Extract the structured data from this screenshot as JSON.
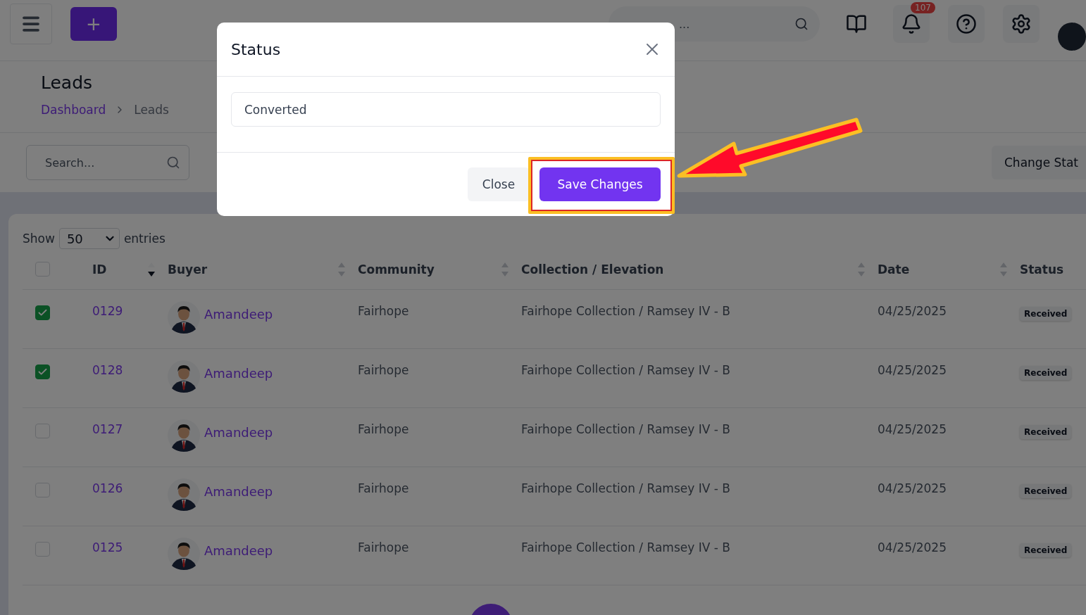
{
  "header": {
    "add_button": "+",
    "search_placeholder": "...",
    "notification_count": "107"
  },
  "page": {
    "title": "Leads",
    "breadcrumb": [
      {
        "label": "Dashboard",
        "link": true
      },
      {
        "label": "Leads",
        "link": false
      }
    ]
  },
  "toolbar": {
    "search_placeholder": "Search...",
    "change_status_button": "Change Stat"
  },
  "table": {
    "show_label": "Show",
    "page_size": "50",
    "entries_label": "entries",
    "select_all_checked": false,
    "columns": [
      {
        "label": "ID",
        "sorted_desc": true
      },
      {
        "label": "Buyer",
        "sorted_desc": false
      },
      {
        "label": "Community",
        "sorted_desc": false
      },
      {
        "label": "Collection / Elevation",
        "sorted_desc": false
      },
      {
        "label": "Date",
        "sorted_desc": false
      },
      {
        "label": "Status"
      }
    ],
    "rows": [
      {
        "checked": true,
        "id": "0129",
        "buyer": "Amandeep",
        "community": "Fairhope",
        "collection": "Fairhope Collection / Ramsey IV - B",
        "date": "04/25/2025",
        "status": "Received"
      },
      {
        "checked": true,
        "id": "0128",
        "buyer": "Amandeep",
        "community": "Fairhope",
        "collection": "Fairhope Collection / Ramsey IV - B",
        "date": "04/25/2025",
        "status": "Received"
      },
      {
        "checked": false,
        "id": "0127",
        "buyer": "Amandeep",
        "community": "Fairhope",
        "collection": "Fairhope Collection / Ramsey IV - B",
        "date": "04/25/2025",
        "status": "Received"
      },
      {
        "checked": false,
        "id": "0126",
        "buyer": "Amandeep",
        "community": "Fairhope",
        "collection": "Fairhope Collection / Ramsey IV - B",
        "date": "04/25/2025",
        "status": "Received"
      },
      {
        "checked": false,
        "id": "0125",
        "buyer": "Amandeep",
        "community": "Fairhope",
        "collection": "Fairhope Collection / Ramsey IV - B",
        "date": "04/25/2025",
        "status": "Received"
      }
    ]
  },
  "modal": {
    "title": "Status",
    "value": "Converted",
    "close_button": "Close",
    "save_button": "Save Changes"
  }
}
